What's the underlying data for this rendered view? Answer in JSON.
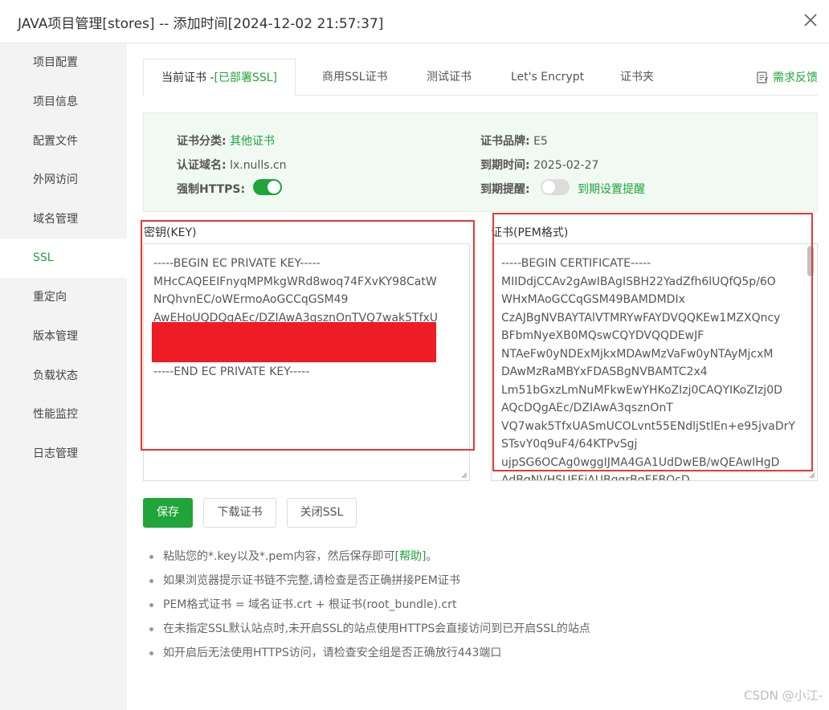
{
  "window": {
    "title": "JAVA项目管理[stores] -- 添加时间[2024-12-02 21:57:37]",
    "close_icon": "close-icon"
  },
  "sidebar": {
    "items": [
      {
        "label": "项目配置"
      },
      {
        "label": "项目信息"
      },
      {
        "label": "配置文件"
      },
      {
        "label": "外网访问"
      },
      {
        "label": "域名管理"
      },
      {
        "label": "SSL",
        "active": true
      },
      {
        "label": "重定向"
      },
      {
        "label": "版本管理"
      },
      {
        "label": "负载状态"
      },
      {
        "label": "性能监控"
      },
      {
        "label": "日志管理"
      }
    ]
  },
  "tabs": {
    "current": {
      "label": "当前证书 -",
      "badge": "[已部署SSL]"
    },
    "commercial": "商用SSL证书",
    "test": "测试证书",
    "letsencrypt": "Let's Encrypt",
    "folder": "证书夹",
    "feedback": "需求反馈"
  },
  "info": {
    "category_label": "证书分类:",
    "category_value": "其他证书",
    "brand_label": "证书品牌:",
    "brand_value": "E5",
    "domain_label": "认证域名:",
    "domain_value": "lx.nulls.cn",
    "expire_label": "到期时间:",
    "expire_value": "2025-02-27",
    "https_label": "强制HTTPS:",
    "https_on": true,
    "reminder_label": "到期提醒:",
    "reminder_on": false,
    "reminder_link": "到期设置提醒"
  },
  "key": {
    "label": "密钥(KEY)",
    "content": "-----BEGIN EC PRIVATE KEY-----\nMHcCAQEEIFnyqMPMkgWRd8woq74FXvKY98CatW\nNrQhvnEC/oWErmoAoGCCqGSM49\nAwEHoUQDQgAEc/DZIAwA3qsznOnTVQ7wak5TfxU\n\n\n-----END EC PRIVATE KEY-----"
  },
  "cert": {
    "label": "证书(PEM格式)",
    "content": "-----BEGIN CERTIFICATE-----\nMIIDdjCCAv2gAwIBAgISBH22YadZfh6lUQfQ5p/6O\nWHxMAoGCCqGSM49BAMDMDIx\nCzAJBgNVBAYTAlVTMRYwFAYDVQQKEw1MZXQncy\nBFbmNyeXB0MQswCQYDVQQDEwJF\nNTAeFw0yNDExMjkxMDAwMzVaFw0yNTAyMjcxM\nDAwMzRaMBYxFDASBgNVBAMTC2x4\nLm51bGxzLmNuMFkwEwYHKoZIzj0CAQYIKoZIzj0D\nAQcDQgAEc/DZIAwA3qsznOnT\nVQ7wak5TfxUASmUCOLvnt55ENdljStlEn+e95jvaDrY\nSTsvY0q9uF4/64KTPvSgj\nujpSG6OCAg0wggIJMA4GA1UdDwEB/wQEAwIHgD\nAdBgNVHSUEFjAUBggrBgEFBQcD"
  },
  "buttons": {
    "save": "保存",
    "download": "下载证书",
    "close_ssl": "关闭SSL"
  },
  "tips": [
    {
      "text": "粘贴您的*.key以及*.pem内容，然后保存即可",
      "link": "[帮助]",
      "suffix": "。"
    },
    {
      "text": "如果浏览器提示证书链不完整,请检查是否正确拼接PEM证书"
    },
    {
      "text": "PEM格式证书 = 域名证书.crt + 根证书(root_bundle).crt"
    },
    {
      "text": "在未指定SSL默认站点时,未开启SSL的站点使用HTTPS会直接访问到已开启SSL的站点"
    },
    {
      "text": "如开启后无法使用HTTPS访问，请检查安全组是否正确放行443端口"
    }
  ],
  "watermark": "CSDN @小江-",
  "colors": {
    "accent": "#20a53a",
    "annotation_red": "#e53935",
    "redaction": "#ee1c25"
  }
}
